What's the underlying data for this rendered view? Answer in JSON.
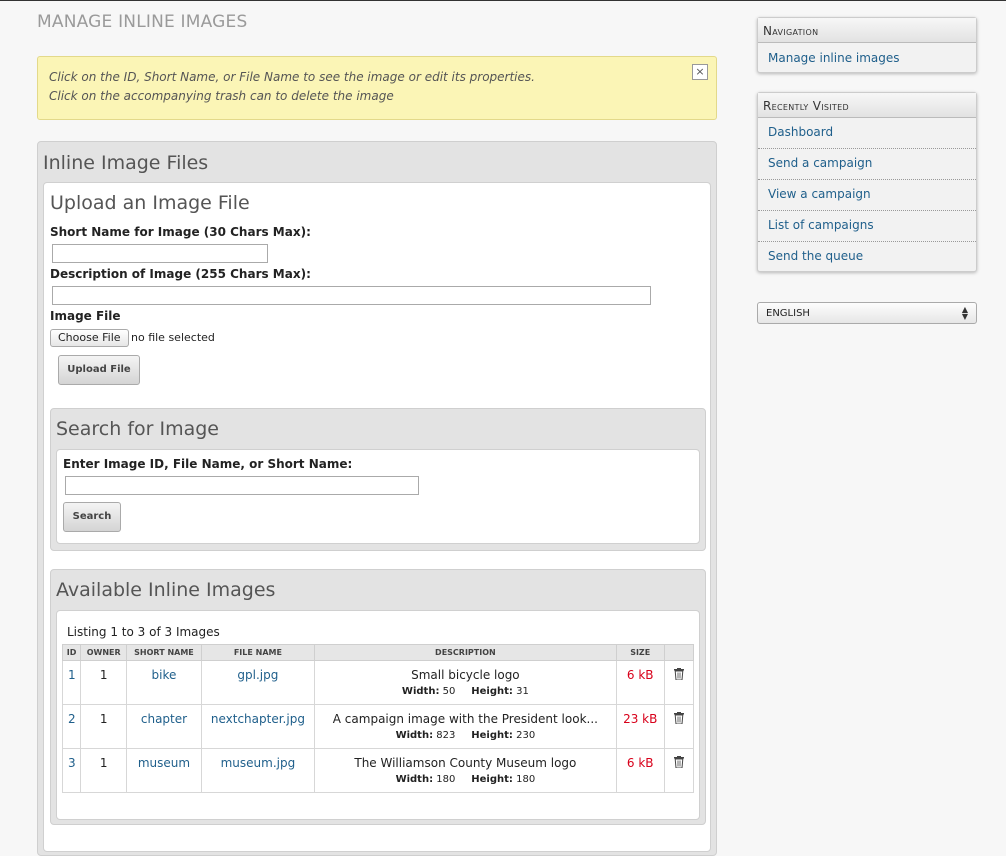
{
  "page": {
    "title": "MANAGE INLINE IMAGES",
    "info_line1": "Click on the ID, Short Name, or File Name to see the image or edit its properties.",
    "info_line2": "Click on the accompanying trash can to delete the image",
    "info_close": "×"
  },
  "main": {
    "panel_title": "Inline Image Files",
    "upload": {
      "title": "Upload an Image File",
      "short_name_label": "Short Name for Image (30 Chars Max):",
      "short_name_value": "",
      "description_label": "Description of Image (255 Chars Max):",
      "description_value": "",
      "file_label": "Image File",
      "choose_file_label": "Choose File",
      "file_status": "no file selected",
      "upload_button": "Upload File"
    },
    "search": {
      "title": "Search for Image",
      "label": "Enter Image ID, File Name, or Short Name:",
      "value": "",
      "button": "Search"
    },
    "available": {
      "title": "Available Inline Images",
      "listing": "Listing 1 to 3 of 3 Images",
      "columns": [
        "ID",
        "OWNER",
        "SHORT NAME",
        "FILE NAME",
        "DESCRIPTION",
        "SIZE",
        ""
      ],
      "width_label": "Width:",
      "height_label": "Height:",
      "rows": [
        {
          "id": "1",
          "owner": "1",
          "short_name": "bike",
          "file_name": "gpl.jpg",
          "description": "Small bicycle logo",
          "width": "50",
          "height": "31",
          "size": "6 kB"
        },
        {
          "id": "2",
          "owner": "1",
          "short_name": "chapter",
          "file_name": "nextchapter.jpg",
          "description": "A campaign image with the President look...",
          "width": "823",
          "height": "230",
          "size": "23 kB"
        },
        {
          "id": "3",
          "owner": "1",
          "short_name": "museum",
          "file_name": "museum.jpg",
          "description": "The Williamson County Museum logo",
          "width": "180",
          "height": "180",
          "size": "6 kB"
        }
      ]
    }
  },
  "sidebar": {
    "navigation": {
      "title": "Navigation",
      "items": [
        {
          "label": "Manage inline images"
        }
      ]
    },
    "recent": {
      "title": "Recently Visited",
      "items": [
        {
          "label": "Dashboard"
        },
        {
          "label": "Send a campaign"
        },
        {
          "label": "View a campaign"
        },
        {
          "label": "List of campaigns"
        },
        {
          "label": "Send the queue"
        }
      ]
    },
    "language": {
      "selected": "ENGLISH"
    }
  },
  "colors": {
    "link": "#1f5f8b",
    "size_text": "#d8001a",
    "info_background": "#fbf5b6",
    "panel_background": "#e3e3e3"
  },
  "icons": {
    "delete": "trash-icon",
    "close": "close-icon",
    "select": "select-arrows-icon"
  }
}
